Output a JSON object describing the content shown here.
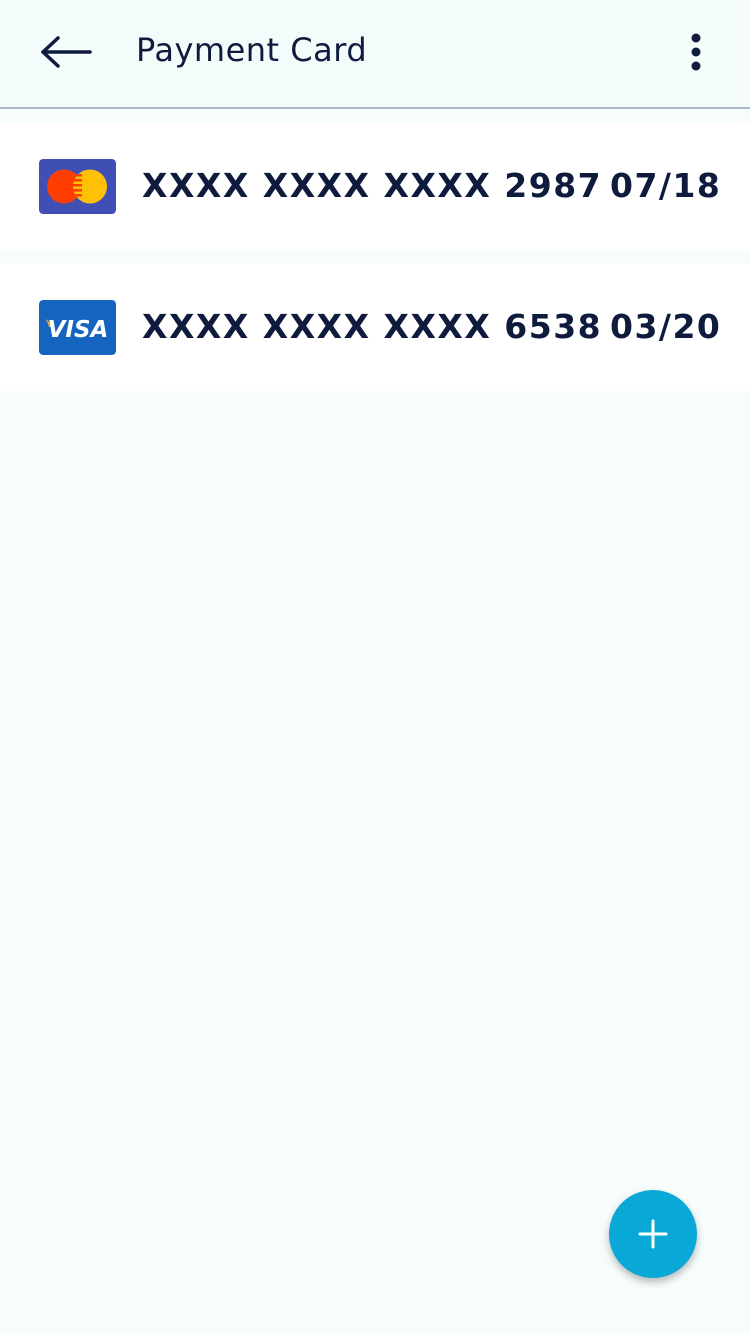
{
  "header": {
    "title": "Payment Card",
    "back_icon": "arrow-left-icon",
    "menu_icon": "more-vertical-icon"
  },
  "cards": [
    {
      "brand": "mastercard",
      "number": "XXXX XXXX XXXX 2987",
      "expiry": "07/18"
    },
    {
      "brand": "visa",
      "brand_label": "VISA",
      "number": "XXXX XXXX XXXX 6538",
      "expiry": "03/20"
    }
  ],
  "fab": {
    "icon": "plus-icon"
  },
  "colors": {
    "background": "#f7fcfc",
    "text": "#0f1b3d",
    "accent": "#0aa8d6",
    "divider": "#aab8c6",
    "mastercard_bg": "#3f4fb4",
    "mastercard_red": "#ff3d00",
    "mastercard_yellow": "#ffc107",
    "visa_bg": "#1565c0",
    "visa_gold": "#f9a825"
  }
}
